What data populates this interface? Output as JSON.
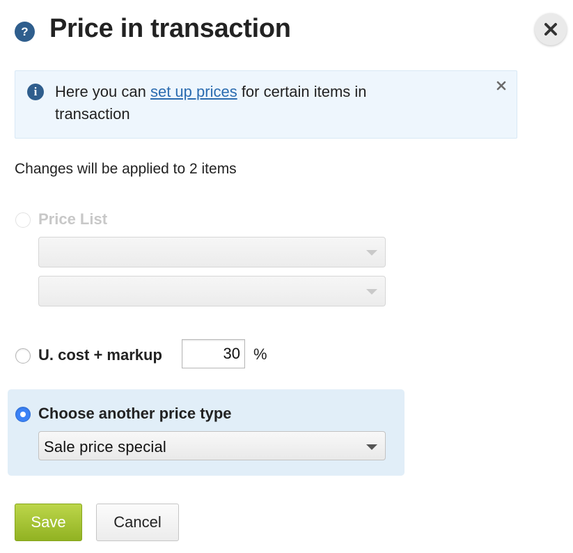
{
  "header": {
    "help_glyph": "?",
    "title": "Price in transaction",
    "close_icon": "close-icon"
  },
  "info": {
    "icon_glyph": "i",
    "text_before": "Here you can ",
    "link_text": "set up prices",
    "text_after": " for certain items in transaction"
  },
  "changes_note": "Changes will be applied to 2 items",
  "options": {
    "price_list": {
      "label": "Price List",
      "selected": false,
      "disabled": true,
      "select_1_value": "",
      "select_2_value": ""
    },
    "cost_markup": {
      "label": "U. cost + markup",
      "selected": false,
      "markup_value": "30",
      "unit": "%"
    },
    "another_type": {
      "label": "Choose another price type",
      "selected": true,
      "select_value": "Sale price special"
    }
  },
  "buttons": {
    "save": "Save",
    "cancel": "Cancel"
  },
  "colors": {
    "accent_blue": "#2f5e8d",
    "radio_checked": "#3b82f6",
    "save_green": "#a4c43a",
    "info_bg": "#eef6fd",
    "highlight_bg": "#e1eef8"
  }
}
